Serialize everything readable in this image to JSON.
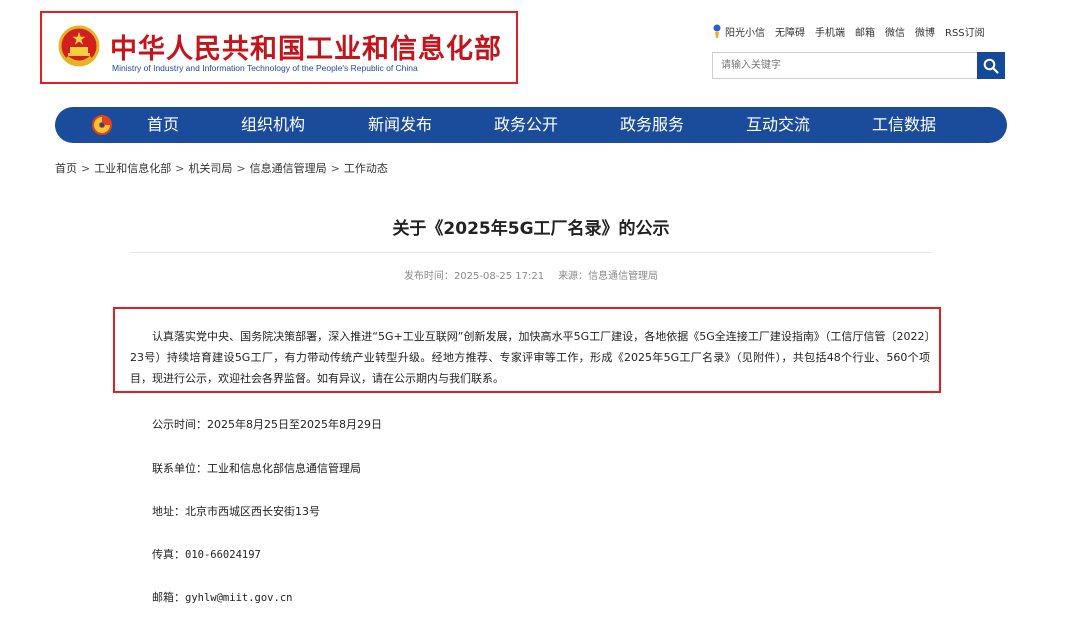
{
  "header": {
    "logo_cn": "中华人民共和国工业和信息化部",
    "logo_en": "Ministry of Industry and Information Technology of the People's Republic of China",
    "toplinks": [
      "阳光小信",
      "无障碍",
      "手机端",
      "邮箱",
      "微信",
      "微博",
      "RSS订阅"
    ],
    "search_placeholder": "请输入关键字",
    "emblem_icon": "national-emblem-icon",
    "search_icon": "search-icon"
  },
  "nav": {
    "items": [
      "首页",
      "组织机构",
      "新闻发布",
      "政务公开",
      "政务服务",
      "互动交流",
      "工信数据"
    ]
  },
  "breadcrumb": [
    "首页",
    "工业和信息化部",
    "机关司局",
    "信息通信管理局",
    "工作动态"
  ],
  "article": {
    "title": "关于《2025年5G工厂名录》的公示",
    "publish_label": "发布时间：",
    "publish_time": "2025-08-25 17:21",
    "source_label": "来源：",
    "source": "信息通信管理局",
    "intro": "认真落实党中央、国务院决策部署，深入推进“5G+工业互联网”创新发展，加快高水平5G工厂建设，各地依据《5G全连接工厂建设指南》（工信厅信管〔2022〕23号）持续培育建设5G工厂，有力带动传统产业转型升级。经地方推荐、专家评审等工作，形成《2025年5G工厂名录》（见附件），共包括48个行业、560个项目，现进行公示，欢迎社会各界监督。如有异议，请在公示期内与我们联系。",
    "period": "公示时间：2025年8月25日至2025年8月29日",
    "contact_unit": "联系单位：工业和信息化部信息通信管理局",
    "address": "地址：北京市西城区西长安街13号",
    "fax_label": "传真：",
    "fax": "010-66024197",
    "email_label": "邮箱：",
    "email": "gyhlw@miit.gov.cn"
  },
  "colors": {
    "brand_red": "#c4151c",
    "nav_blue": "#1a4c9b",
    "highlight_red": "#e02020"
  }
}
